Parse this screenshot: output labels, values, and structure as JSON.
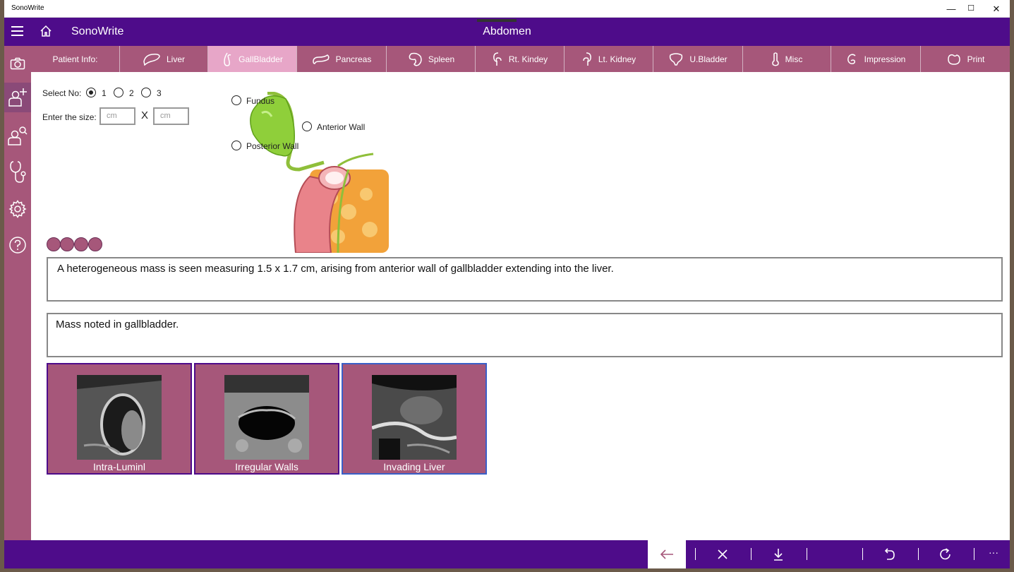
{
  "window": {
    "title": "SonoWrite",
    "controls": {
      "minimize": "—",
      "maximize": "☐",
      "close": "✕"
    }
  },
  "header": {
    "app_name": "SonoWrite",
    "section": "Abdomen"
  },
  "sidebar": {
    "items": [
      {
        "icon": "camera-icon"
      },
      {
        "icon": "add-patient-icon",
        "active": true
      },
      {
        "icon": "search-patient-icon"
      },
      {
        "icon": "stethoscope-icon"
      },
      {
        "icon": "gear-icon"
      },
      {
        "icon": "help-icon"
      }
    ]
  },
  "tabs": [
    {
      "label": "Patient Info:",
      "icon": ""
    },
    {
      "label": "Liver",
      "icon": "liver-icon"
    },
    {
      "label": "GallBladder",
      "icon": "gallbladder-icon",
      "active": true
    },
    {
      "label": "Pancreas",
      "icon": "pancreas-icon"
    },
    {
      "label": "Spleen",
      "icon": "spleen-icon"
    },
    {
      "label": "Rt. Kindey",
      "icon": "right-kidney-icon"
    },
    {
      "label": "Lt. Kidney",
      "icon": "left-kidney-icon"
    },
    {
      "label": "U.Bladder",
      "icon": "urinary-bladder-icon"
    },
    {
      "label": "Misc",
      "icon": "thermometer-icon"
    },
    {
      "label": "Impression",
      "icon": "impression-icon"
    },
    {
      "label": "Print",
      "icon": "print-icon"
    }
  ],
  "form": {
    "select_no_label": "Select No:",
    "select_options": [
      "1",
      "2",
      "3"
    ],
    "selected": "1",
    "size_label": "Enter the size:",
    "size_placeholder_1": "cm",
    "size_placeholder_2": "cm",
    "size_separator": "X"
  },
  "diagram": {
    "locations": [
      "Fundus",
      "Anterior Wall",
      "Posterior Wall"
    ]
  },
  "findings_text": "A heterogeneous mass is seen measuring 1.5 x 1.7 cm, arising from anterior wall of gallbladder extending into the liver.",
  "impression_text": "Mass noted in gallbladder.",
  "cards": [
    {
      "label": "Intra-Luminl"
    },
    {
      "label": "Irregular Walls"
    },
    {
      "label": "Invading Liver",
      "selected": true
    }
  ],
  "bottom_bar": {
    "buttons": [
      "back-arrow-icon",
      "close-icon",
      "download-icon",
      "undo-icon",
      "refresh-icon"
    ],
    "more_label": "···"
  },
  "colors": {
    "header": "#4e0c8a",
    "accent": "#a6577a",
    "tab_active": "#e7a6c8"
  }
}
